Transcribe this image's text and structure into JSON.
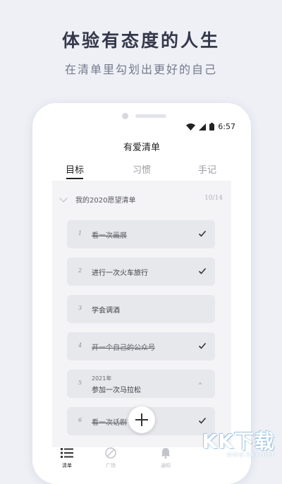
{
  "promo": {
    "title": "体验有态度的人生",
    "subtitle": "在清单里勾划出更好的自己"
  },
  "status_bar": {
    "time": "6:57",
    "icons": [
      "wifi-icon",
      "battery-icon"
    ]
  },
  "app": {
    "title": "有爱清单"
  },
  "tabs": [
    {
      "label": "目标",
      "active": true
    },
    {
      "label": "习惯",
      "active": false
    },
    {
      "label": "手记",
      "active": false
    }
  ],
  "group": {
    "title": "我的2020愿望清单",
    "count": "10/14"
  },
  "items": [
    {
      "num": "1",
      "text": "看一次画展",
      "done": true
    },
    {
      "num": "2",
      "text": "进行一次火车旅行",
      "done": false
    },
    {
      "num": "3",
      "text": "学会调酒",
      "done": false
    },
    {
      "num": "4",
      "text": "开一个自己的公众号",
      "done": true
    },
    {
      "num": "5",
      "date": "2021年",
      "text": "参加一次马拉松",
      "done": false
    },
    {
      "num": "6",
      "text": "看一次话剧",
      "done": true
    }
  ],
  "bottom_nav": [
    {
      "label": "清单",
      "icon": "list-icon",
      "active": true
    },
    {
      "label": "广场",
      "icon": "compass-icon",
      "active": false
    },
    {
      "label": "通知",
      "icon": "bell-icon",
      "active": false
    }
  ],
  "watermark": {
    "logo": "KK下载",
    "url": "www.kkx.net"
  },
  "colors": {
    "background": "#eef0f6",
    "card": "#e7e8ec",
    "text_dark": "#34384a"
  }
}
